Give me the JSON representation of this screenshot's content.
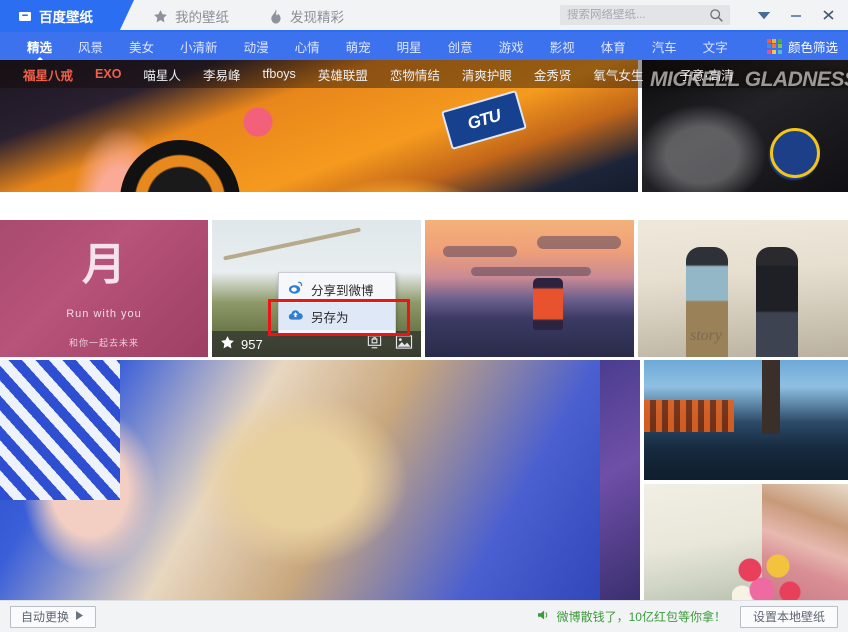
{
  "titlebar": {
    "tabs": [
      {
        "label": "百度壁纸",
        "icon": "baidu-box-icon",
        "active": true
      },
      {
        "label": "我的壁纸",
        "icon": "star-icon",
        "active": false
      },
      {
        "label": "发现精彩",
        "icon": "flame-icon",
        "active": false
      }
    ],
    "search": {
      "placeholder": "搜索网络壁纸...",
      "value": "",
      "icon": "search-icon"
    },
    "window_buttons": [
      {
        "name": "menu-button",
        "glyph": "▼"
      },
      {
        "name": "minimize-button",
        "glyph": "−"
      },
      {
        "name": "close-button",
        "glyph": "✕"
      }
    ]
  },
  "nav": {
    "items": [
      {
        "label": "精选",
        "active": true
      },
      {
        "label": "风景",
        "active": false
      },
      {
        "label": "美女",
        "active": false
      },
      {
        "label": "小清新",
        "active": false
      },
      {
        "label": "动漫",
        "active": false
      },
      {
        "label": "心情",
        "active": false
      },
      {
        "label": "萌宠",
        "active": false
      },
      {
        "label": "明星",
        "active": false
      },
      {
        "label": "创意",
        "active": false
      },
      {
        "label": "游戏",
        "active": false
      },
      {
        "label": "影视",
        "active": false
      },
      {
        "label": "体育",
        "active": false
      },
      {
        "label": "汽车",
        "active": false
      },
      {
        "label": "文字",
        "active": false
      }
    ],
    "color_filter": {
      "label": "颜色筛选",
      "icon": "color-grid-icon",
      "swatches": [
        "#f25c4e",
        "#f0b429",
        "#4aa84a",
        "#3d8fe0",
        "#f2724e",
        "#8bc34a",
        "#e84f8f",
        "#f2c94c",
        "#4ec3c9"
      ]
    }
  },
  "tagbar": {
    "tags": [
      {
        "label": "福星八戒",
        "hot": true
      },
      {
        "label": "EXO",
        "hot": true
      },
      {
        "label": "喵星人",
        "hot": false
      },
      {
        "label": "李易峰",
        "hot": false
      },
      {
        "label": "tfboys",
        "hot": false
      },
      {
        "label": "英雄联盟",
        "hot": false
      },
      {
        "label": "恋物情结",
        "hot": false
      },
      {
        "label": "清爽护眼",
        "hot": false
      },
      {
        "label": "金秀贤",
        "hot": false
      },
      {
        "label": "氧气女生",
        "hot": false
      }
    ],
    "last_tag": "子意·高清"
  },
  "wallpapers": {
    "car": {
      "plate_text": "GTU"
    },
    "basketball": {
      "caption": "MICKELL GLADNESS"
    },
    "pink": {
      "mark": "月",
      "line1": "Run with you",
      "line2": "和你一起去未来"
    },
    "men": {
      "caption": "story"
    },
    "hovered": {
      "favorite_count": "957",
      "star_icon": "star-icon",
      "set-wallpaper_icon": "monitor-lock-icon",
      "preview_icon": "picture-icon"
    }
  },
  "context_menu": {
    "items": [
      {
        "label": "分享到微博",
        "icon": "weibo-icon",
        "highlighted": false
      },
      {
        "label": "另存为",
        "icon": "save-cloud-icon",
        "highlighted": true
      }
    ],
    "highlight_color": "#ef1414"
  },
  "footer": {
    "auto_change_label": "自动更换",
    "auto_change_icon": "play-icon",
    "promo_icon": "speaker-icon",
    "promo_text": "微博散钱了，10亿红包等你拿！",
    "promo_color": "#3e9a3c",
    "local_wallpaper_label": "设置本地壁纸"
  }
}
